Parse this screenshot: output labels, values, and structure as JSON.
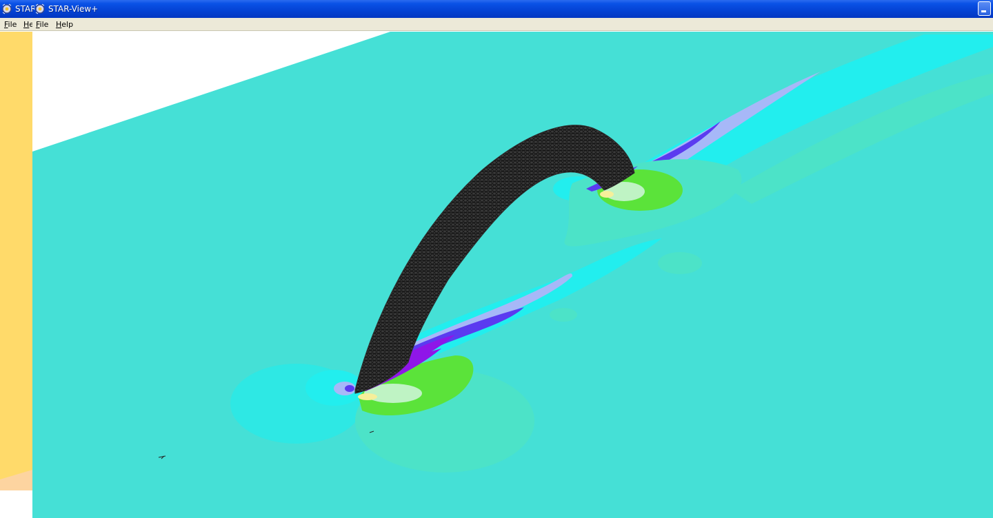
{
  "window": {
    "background_title": "STAR-View+",
    "title": "STAR-View+",
    "icon": "star-view-icon"
  },
  "background_menu": [
    "File",
    "Help"
  ],
  "menu": {
    "file": "File",
    "help": "Help"
  },
  "scene": {
    "description_icon": "cfd-contour-view",
    "colors": {
      "plane": "#45e0d6",
      "plane_light": "#4ce3c8",
      "cyan": "#22eeee",
      "light_blue": "#a7b8f8",
      "blue": "#5b3bf0",
      "violet": "#8f16e8",
      "green": "#5be33a",
      "pale_green": "#bff3c4",
      "yellow": "#f6ef9a",
      "orange_panel": "#ffda6a",
      "mesh": "#2c2c2c"
    }
  }
}
